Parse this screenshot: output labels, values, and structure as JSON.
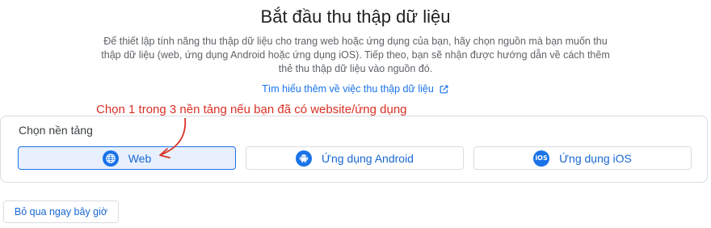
{
  "header": {
    "title": "Bắt đầu thu thập dữ liệu",
    "description": "Để thiết lập tính năng thu thập dữ liệu cho trang web hoặc ứng dụng của bạn, hãy chọn nguồn mà bạn muốn thu thập dữ liệu (web, ứng dụng Android hoặc ứng dụng iOS). Tiếp theo, bạn sẽ nhận được hướng dẫn về cách thêm thẻ thu thập dữ liệu vào nguồn đó.",
    "learn_more": "Tìm hiểu thêm về việc thu thập dữ liệu"
  },
  "annotation": {
    "text": "Chọn 1 trong 3 nền tảng nếu bạn đã có website/ứng dụng",
    "color": "#d93025"
  },
  "platforms": {
    "label": "Chọn nền tảng",
    "items": [
      {
        "label": "Web",
        "icon": "globe-icon",
        "selected": true
      },
      {
        "label": "Ứng dụng Android",
        "icon": "android-icon",
        "selected": false
      },
      {
        "label": "Ứng dụng iOS",
        "icon": "ios-icon",
        "selected": false
      }
    ]
  },
  "ios_badge": "iOS",
  "skip_button": "Bỏ qua ngay bây giờ",
  "colors": {
    "accent": "#1a73e8",
    "selected_bg": "#e8f0fe"
  }
}
